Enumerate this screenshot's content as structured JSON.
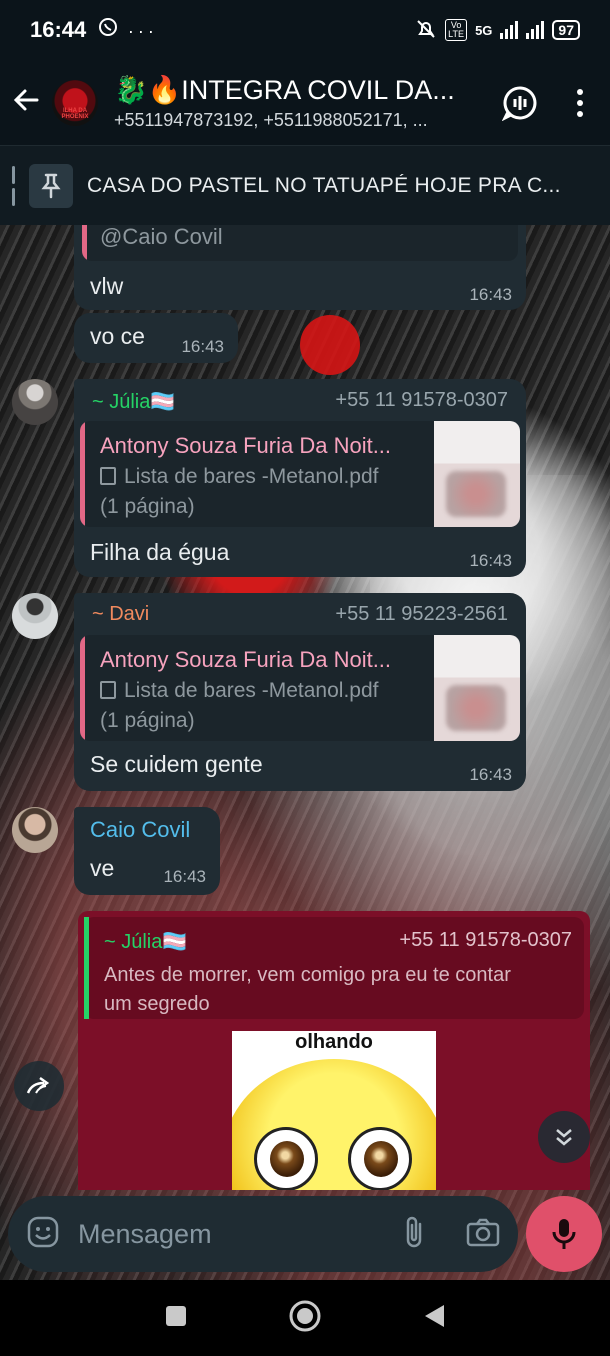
{
  "status_bar": {
    "time": "16:44",
    "left_icons": "whatsapp-icon · more-dots",
    "network": "5G",
    "volte": "Vo LTE",
    "battery": "97"
  },
  "header": {
    "title": "🐉🔥INTEGRA COVIL DA...",
    "subtitle": "+5511947873192, +5511988052171, ...",
    "avatar_text": "ILHA DA PHOENIX"
  },
  "pinned": {
    "text": "CASA DO PASTEL NO TATUAPÉ HOJE PRA C..."
  },
  "messages": [
    {
      "id": "m1",
      "quote_mention": "@Caio Covil",
      "text": "vlw",
      "time": "16:43"
    },
    {
      "id": "m2",
      "text": "vo ce",
      "time": "16:43"
    },
    {
      "id": "m3",
      "sender": "~ Júlia🏳️‍⚧️",
      "phone": "+55 11 91578-0307",
      "quote_title": "Antony Souza Furia Da Noit...",
      "quote_doc": "Lista de bares -Metanol.pdf",
      "quote_pages": "(1 página)",
      "text": "Filha da égua",
      "time": "16:43"
    },
    {
      "id": "m4",
      "sender": "~ Davi",
      "phone": "+55 11 95223-2561",
      "quote_title": "Antony Souza Furia Da Noit...",
      "quote_doc": "Lista de bares -Metanol.pdf",
      "quote_pages": "(1 página)",
      "text": "Se cuidem gente",
      "time": "16:43"
    },
    {
      "id": "m5",
      "sender": "Caio Covil",
      "text": "ve",
      "time": "16:43"
    },
    {
      "id": "m6",
      "quote_sender": "~ Júlia🏳️‍⚧️",
      "quote_phone": "+55 11 91578-0307",
      "quote_text": "Antes de morrer, vem comigo pra eu te contar um segredo",
      "sticker_caption": "olhando"
    }
  ],
  "input": {
    "placeholder": "Mensagem"
  },
  "colors": {
    "julia_name": "#53bdeb",
    "davi_name": "#f18a5e",
    "caio_name": "#53bdeb",
    "quote_bar_pink": "#e26886",
    "reply_bubble": "#7c0f28",
    "reply_bar_green": "#25d366",
    "mic_button": "#e0506a"
  }
}
